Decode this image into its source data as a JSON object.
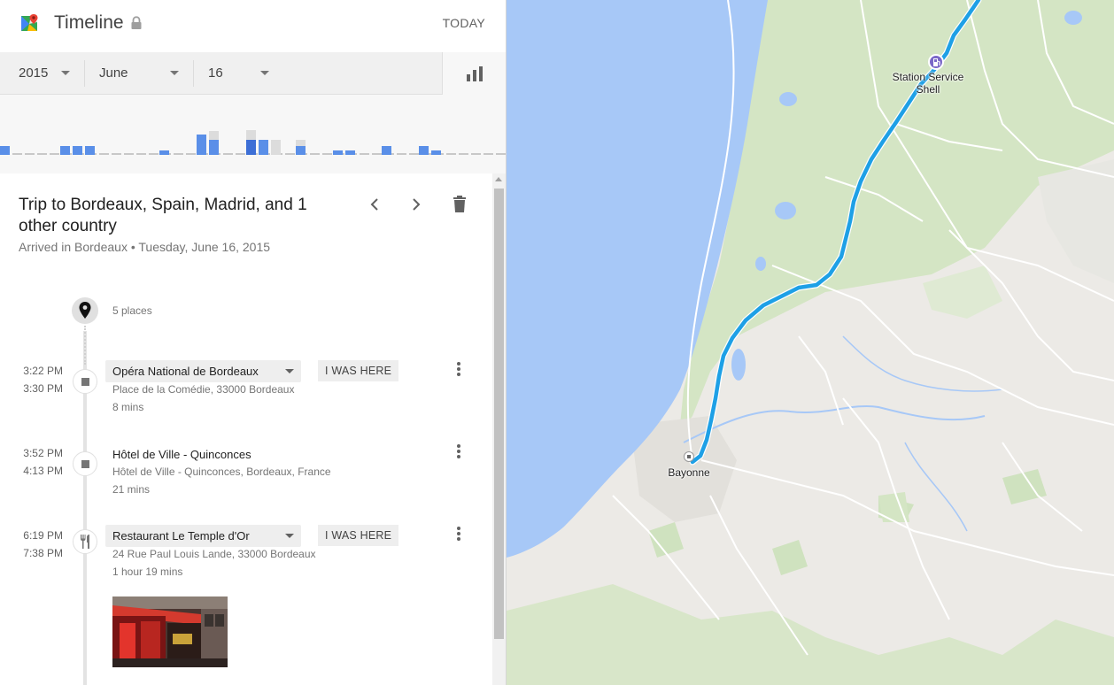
{
  "header": {
    "app_title": "Timeline",
    "today_label": "TODAY"
  },
  "date_selector": {
    "year": "2015",
    "month": "June",
    "day": "16"
  },
  "trip": {
    "title": "Trip to Bordeaux, Spain, Madrid, and 1 other country",
    "subtitle": "Arrived in Bordeaux • Tuesday, June 16, 2015",
    "places_count": "5 places"
  },
  "stops": [
    {
      "start": "3:22 PM",
      "end": "3:30 PM",
      "name": "Opéra National de Bordeaux",
      "address": "Place de la Comédie, 33000 Bordeaux",
      "duration": "8 mins",
      "action": "I WAS HERE",
      "icon": "square-stop-icon"
    },
    {
      "start": "3:52 PM",
      "end": "4:13 PM",
      "name": "Hôtel de Ville - Quinconces",
      "address": "Hôtel de Ville - Quinconces, Bordeaux, France",
      "duration": "21 mins",
      "icon": "square-stop-icon"
    },
    {
      "start": "6:19 PM",
      "end": "7:38 PM",
      "name": "Restaurant Le Temple d'Or",
      "address": "24 Rue Paul Louis Lande, 33000 Bordeaux",
      "duration": "1 hour 19 mins",
      "action": "I WAS HERE",
      "icon": "restaurant-icon"
    }
  ],
  "map": {
    "labels": {
      "station": "Station Service Shell",
      "city": "Bayonne"
    },
    "colors": {
      "route": "#1ea0e6",
      "sea": "#a7c8f7",
      "land": "#eceae6",
      "forest": "#d4e5c4"
    }
  },
  "histogram": {
    "colors": {
      "strong": "#3d6fd6",
      "medium": "#5a8fe8",
      "light": "#dcdcdc",
      "empty": "#c8c8c8"
    }
  }
}
